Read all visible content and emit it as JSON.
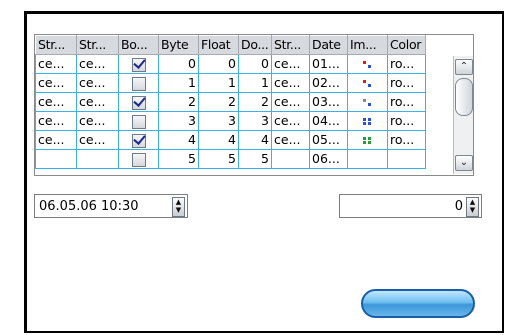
{
  "grid": {
    "columns": [
      "Str...",
      "Str...",
      "Bo...",
      "Byte",
      "Float",
      "Do...",
      "Str...",
      "Date",
      "Im...",
      "Color"
    ],
    "rows": [
      {
        "s1": "ce...",
        "s2": "ce...",
        "checked": true,
        "byte": "0",
        "float": "0",
        "dbl": "0",
        "s3": "ce...",
        "date": "01...",
        "img": "image-red-blue",
        "color": "ro..."
      },
      {
        "s1": "ce...",
        "s2": "ce...",
        "checked": false,
        "byte": "1",
        "float": "1",
        "dbl": "1",
        "s3": "ce...",
        "date": "02...",
        "img": "image-red-blue",
        "color": "ro..."
      },
      {
        "s1": "ce...",
        "s2": "ce...",
        "checked": true,
        "byte": "2",
        "float": "2",
        "dbl": "2",
        "s3": "ce...",
        "date": "03...",
        "img": "image-gray-blue",
        "color": "ro..."
      },
      {
        "s1": "ce...",
        "s2": "ce...",
        "checked": false,
        "byte": "3",
        "float": "3",
        "dbl": "3",
        "s3": "ce...",
        "date": "04...",
        "img": "image-blue-four",
        "color": "ro..."
      },
      {
        "s1": "ce...",
        "s2": "ce...",
        "checked": true,
        "byte": "4",
        "float": "4",
        "dbl": "4",
        "s3": "ce...",
        "date": "05...",
        "img": "image-green-four",
        "color": "ro..."
      },
      {
        "s1": "",
        "s2": "",
        "checked": false,
        "byte": "5",
        "float": "5",
        "dbl": "5",
        "s3": "",
        "date": "06...",
        "img": "",
        "color": ""
      }
    ]
  },
  "datetime_field": {
    "value": "06.05.06 10:30"
  },
  "number_field": {
    "value": "0"
  },
  "scrollbar": {
    "up_icon": "chevron-up-icon",
    "down_icon": "chevron-down-icon"
  },
  "colors": {
    "grid_line": "#3cb1e6",
    "header_bg": "#d6d9de",
    "checkmark": "#1a2a8e",
    "button_blue": "#3c97da"
  }
}
